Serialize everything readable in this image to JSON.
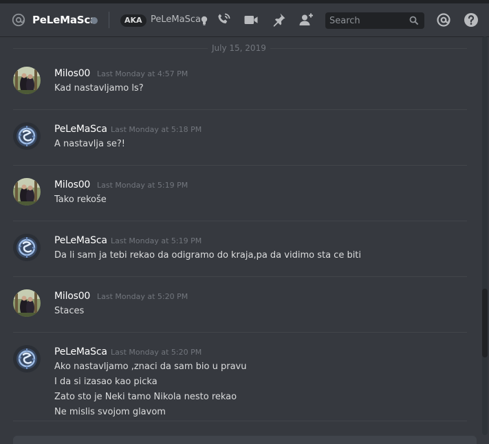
{
  "header": {
    "at_icon": "at-icon",
    "username": "PeLeMaSca",
    "status": "offline",
    "aka_label": "AKA",
    "aka_name": "PeLeMaSca",
    "icons": [
      "bulb-icon",
      "phone-call-icon",
      "video-call-icon",
      "pin-icon",
      "add-friend-icon",
      "mention-icon",
      "help-icon"
    ]
  },
  "search": {
    "placeholder": "Search"
  },
  "date_divider": "July 15, 2019",
  "messages": [
    {
      "author": "Milos00",
      "time": "Last Monday at 4:57 PM",
      "lines": [
        "Kad nastavljamo ls?"
      ]
    },
    {
      "author": "PeLeMaSca",
      "time": "Last Monday at 5:18 PM",
      "lines": [
        "A nastavlja se?!"
      ]
    },
    {
      "author": "Milos00",
      "time": "Last Monday at 5:19 PM",
      "lines": [
        "Tako rekoše"
      ]
    },
    {
      "author": "PeLeMaSca",
      "time": "Last Monday at 5:19 PM",
      "lines": [
        "Da li sam ja tebi rekao da odigramo do kraja,pa da vidimo sta ce biti"
      ]
    },
    {
      "author": "Milos00",
      "time": "Last Monday at 5:20 PM",
      "lines": [
        "Staces"
      ]
    },
    {
      "author": "PeLeMaSca",
      "time": "Last Monday at 5:20 PM",
      "lines": [
        "Ako nastavljamo ,znaci da sam bio u pravu",
        "I da si izasao kao picka",
        "Zato sto je Neki tamo Nikola nesto rekao",
        "Ne mislis svojom glavom"
      ]
    }
  ],
  "colors": {
    "background": "#36393f",
    "text": "#dcddde",
    "muted": "#72767d",
    "username": "#ffffff"
  }
}
